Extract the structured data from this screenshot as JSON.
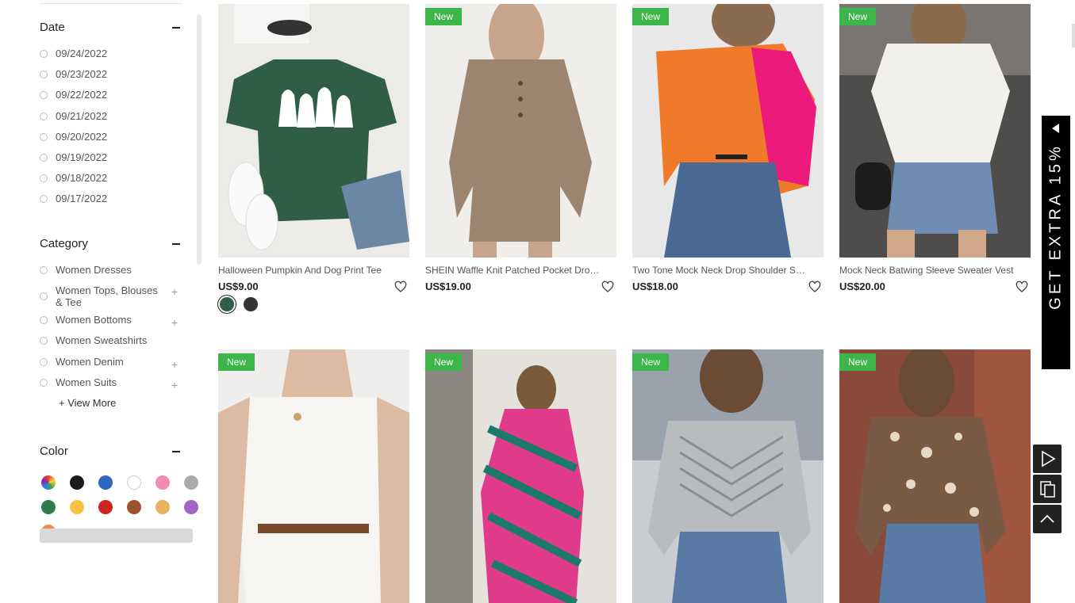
{
  "filters": {
    "date": {
      "title": "Date",
      "options": [
        "09/24/2022",
        "09/23/2022",
        "09/22/2022",
        "09/21/2022",
        "09/20/2022",
        "09/19/2022",
        "09/18/2022",
        "09/17/2022"
      ]
    },
    "category": {
      "title": "Category",
      "options": [
        {
          "label": "Women Dresses",
          "expandable": false
        },
        {
          "label": "Women Tops, Blouses & Tee",
          "expandable": true
        },
        {
          "label": "Women Bottoms",
          "expandable": true
        },
        {
          "label": "Women Sweatshirts",
          "expandable": false
        },
        {
          "label": "Women Denim",
          "expandable": true
        },
        {
          "label": "Women Suits",
          "expandable": true
        }
      ],
      "view_more": "+ View More"
    },
    "color": {
      "title": "Color",
      "swatches": [
        "#e05050",
        "#1a1a1a",
        "#2e66c4",
        "#ffffff",
        "#f28ab6",
        "#aaaaaa",
        "#2e7d4f",
        "#f5c542",
        "#d32222",
        "#a0522d",
        "#e8b060",
        "#a366c8",
        "#f08a4b"
      ]
    }
  },
  "products": [
    {
      "name": "Halloween Pumpkin And Dog Print Tee",
      "price": "US$9.00",
      "is_new": false,
      "badge": "",
      "colors": [
        "#2f5d46",
        "#333333"
      ]
    },
    {
      "name": "SHEIN Waffle Knit Patched Pocket Drop Shoulder",
      "price": "US$19.00",
      "is_new": true,
      "badge": "New",
      "colors": []
    },
    {
      "name": "Two Tone Mock Neck Drop Shoulder Sweater",
      "price": "US$18.00",
      "is_new": true,
      "badge": "New",
      "colors": []
    },
    {
      "name": "Mock Neck Batwing Sleeve Sweater Vest",
      "price": "US$20.00",
      "is_new": true,
      "badge": "New",
      "colors": []
    },
    {
      "name": "",
      "price": "",
      "is_new": true,
      "badge": "New",
      "colors": []
    },
    {
      "name": "",
      "price": "",
      "is_new": true,
      "badge": "New",
      "colors": []
    },
    {
      "name": "",
      "price": "",
      "is_new": true,
      "badge": "New",
      "colors": []
    },
    {
      "name": "",
      "price": "",
      "is_new": true,
      "badge": "New",
      "colors": []
    }
  ],
  "promo": {
    "text": "GET EXTRA 15%"
  },
  "tools": [
    "play-icon",
    "copy-icon",
    "back-to-top-icon"
  ]
}
